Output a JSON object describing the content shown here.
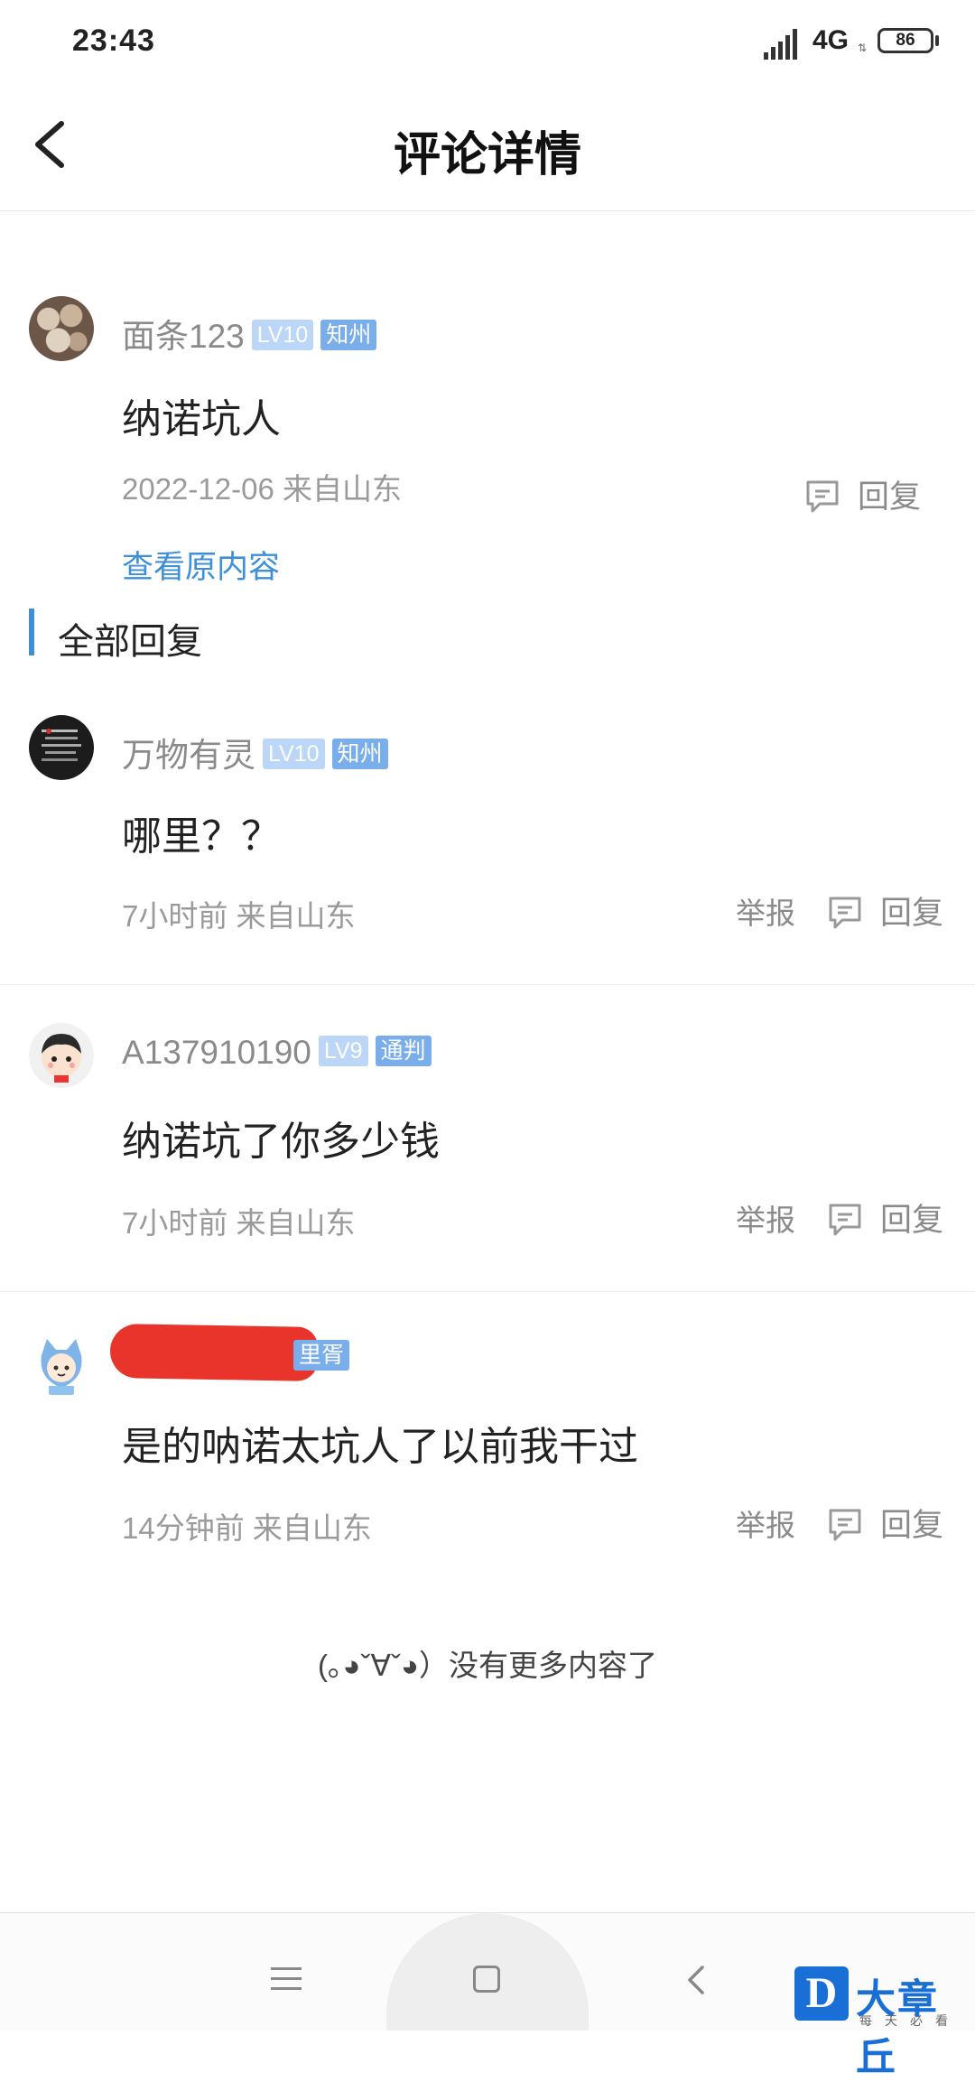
{
  "status_bar": {
    "time": "23:43",
    "network": "4G",
    "battery": "86"
  },
  "header": {
    "title": "评论详情"
  },
  "main_comment": {
    "username": "面条123",
    "level": "LV10",
    "title_badge": "知州",
    "content": "纳诺坑人",
    "time": "2022-12-06",
    "location": "来自山东",
    "reply_label": "回复",
    "view_original": "查看原内容"
  },
  "replies_section": {
    "title": "全部回复"
  },
  "replies": [
    {
      "username": "万物有灵",
      "level": "LV10",
      "title_badge": "知州",
      "content": "哪里？？",
      "time": "7小时前",
      "location": "来自山东",
      "report_label": "举报",
      "reply_label": "回复"
    },
    {
      "username": "A137910190",
      "level": "LV9",
      "title_badge": "通判",
      "content": "纳诺坑了你多少钱",
      "time": "7小时前",
      "location": "来自山东",
      "report_label": "举报",
      "reply_label": "回复"
    },
    {
      "username": "",
      "level": "",
      "title_badge": "里胥",
      "content": "是的呐诺太坑人了以前我干过",
      "time": "14分钟前",
      "location": "来自山东",
      "report_label": "举报",
      "reply_label": "回复"
    }
  ],
  "footer": {
    "end_text": "(｡◕ˇ∀ˇ◕）没有更多内容了"
  },
  "watermark": {
    "logo": "D",
    "text": "大章丘",
    "sub": "每天必看"
  },
  "colors": {
    "accent": "#3d8fd8",
    "badge_level": "#bcd6f7",
    "badge_title": "#79aeea",
    "redaction": "#e8342a"
  }
}
